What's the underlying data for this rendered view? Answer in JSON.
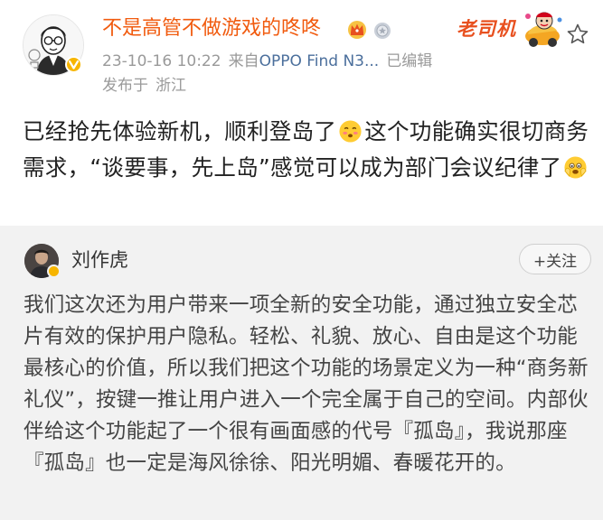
{
  "post": {
    "author": "不是高管不做游戏的咚咚",
    "badges": [
      "crown-badge-icon",
      "medal-badge-icon"
    ],
    "sticker_text": "老司机",
    "meta": {
      "time": "23-10-16 10:22",
      "source_prefix": "来自",
      "device": "OPPO Find N3...",
      "edited": "已编辑"
    },
    "location_prefix": "发布于",
    "location": "浙江",
    "text_parts": [
      "已经抢先体验新机，顺利登岛了",
      "这个功能确实很切商务需求，“谈要事，先上岛”感觉可以成为部门会议纪律了"
    ],
    "emojis": [
      "blushing-face-icon",
      "fearful-face-icon"
    ]
  },
  "quote": {
    "author": "刘作虎",
    "follow_label": "+关注",
    "text": "我们这次还为用户带来一项全新的安全功能，通过独立安全芯片有效的保护用户隐私。轻松、礼貌、放心、自由是这个功能最核心的价值，所以我们把这个功能的场景定义为一种“商务新礼仪”，按键一推让用户进入一个完全属于自己的空间。内部伙伴给这个功能起了一个很有画面感的代号『孤岛』，我说那座『孤岛』也一定是海风徐徐、阳光明媚、春暖花开的。"
  },
  "colors": {
    "author": "#f15b0f",
    "device_link": "#4b6f9c",
    "meta": "#9a9a9a",
    "verified": "#f7b500"
  }
}
